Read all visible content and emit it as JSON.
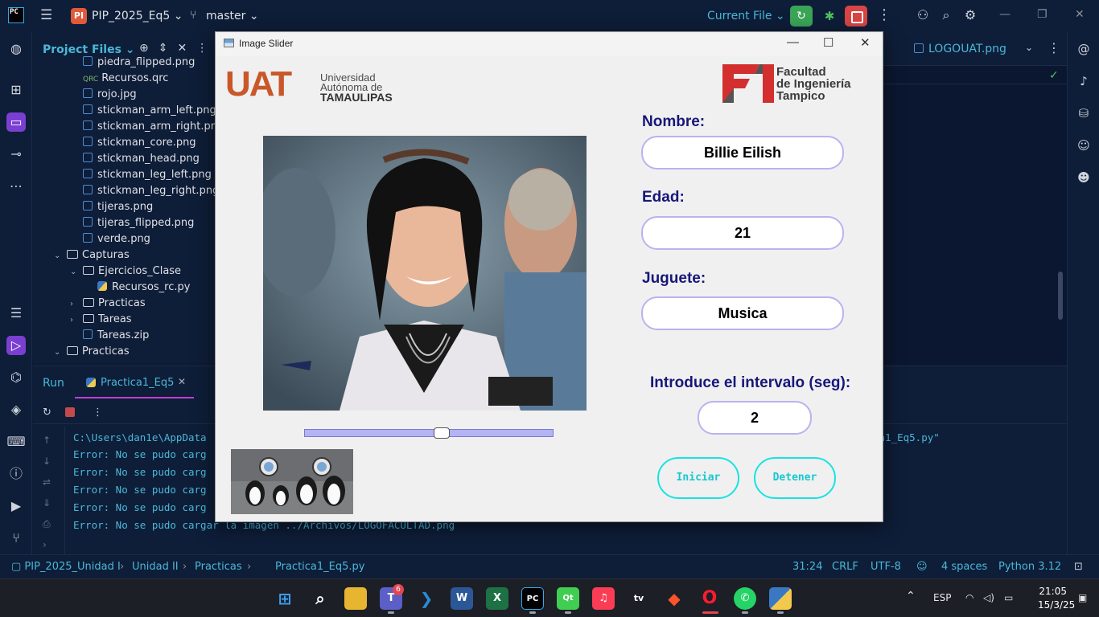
{
  "ide": {
    "logo_text": "PC",
    "project_badge": "PI",
    "project_name": "PIP_2025_Eq5 ⌄",
    "branch": "master ⌄",
    "current_file": "Current File ⌄",
    "project_panel_title": "Project Files ⌄",
    "tree": [
      {
        "label": "piedra_flipped.png",
        "type": "image",
        "indent": 3
      },
      {
        "label": "Recursos.qrc",
        "type": "qrc",
        "indent": 3
      },
      {
        "label": "rojo.jpg",
        "type": "image",
        "indent": 3
      },
      {
        "label": "stickman_arm_left.png",
        "type": "image",
        "indent": 3
      },
      {
        "label": "stickman_arm_right.png",
        "type": "image",
        "indent": 3
      },
      {
        "label": "stickman_core.png",
        "type": "image",
        "indent": 3
      },
      {
        "label": "stickman_head.png",
        "type": "image",
        "indent": 3
      },
      {
        "label": "stickman_leg_left.png",
        "type": "image",
        "indent": 3
      },
      {
        "label": "stickman_leg_right.png",
        "type": "image",
        "indent": 3
      },
      {
        "label": "tijeras.png",
        "type": "image",
        "indent": 3
      },
      {
        "label": "tijeras_flipped.png",
        "type": "image",
        "indent": 3
      },
      {
        "label": "verde.png",
        "type": "image",
        "indent": 3
      },
      {
        "label": "Capturas",
        "type": "folder-open",
        "indent": 2
      },
      {
        "label": "Ejercicios_Clase",
        "type": "folder-open",
        "indent": 3
      },
      {
        "label": "Recursos_rc.py",
        "type": "python",
        "indent": 4
      },
      {
        "label": "Practicas",
        "type": "folder-closed",
        "indent": 3
      },
      {
        "label": "Tareas",
        "type": "folder-closed",
        "indent": 3
      },
      {
        "label": "Tareas.zip",
        "type": "image",
        "indent": 3
      },
      {
        "label": "Practicas",
        "type": "folder-open",
        "indent": 2
      }
    ],
    "editor_tab": "LOGOUAT.png",
    "run_label": "Run",
    "run_tab": "Practica1_Eq5",
    "console": [
      "C:\\Users\\dan1e\\AppData",
      "Error: No se pudo carg",
      "Error: No se pudo carg",
      "Error: No se pudo carg",
      "Error: No se pudo carg",
      "Error: No se pudo cargar la imagen ../Archivos/LOGOFACULTAD.png"
    ],
    "console_right": "ca1_Eq5.py\"",
    "status": {
      "breadcrumb": [
        "PIP_2025_Unidad I",
        "Unidad II",
        "Practicas",
        "Practica1_Eq5.py"
      ],
      "position": "31:24",
      "line_ending": "CRLF",
      "encoding": "UTF-8",
      "indent": "4 spaces",
      "interpreter": "Python 3.12"
    }
  },
  "app": {
    "window_title": "Image Slider",
    "uat_logo": {
      "big": "UAT",
      "line1": "Universidad",
      "line2": "Autónoma de",
      "line3": "TAMAULIPAS"
    },
    "fi_logo": {
      "line1": "Facultad",
      "line2": "de Ingeniería",
      "line3": "Tampico"
    },
    "nombre_label": "Nombre:",
    "nombre_value": "Billie Eilish",
    "edad_label": "Edad:",
    "edad_value": "21",
    "juguete_label": "Juguete:",
    "juguete_value": "Musica",
    "interval_label": "Introduce el intervalo (seg):",
    "interval_value": "2",
    "start_button": "Iniciar",
    "stop_button": "Detener",
    "slider_position": 0.55
  },
  "taskbar": {
    "teams_badge": "6",
    "lang": "ESP",
    "time": "21:05",
    "date": "15/3/25"
  }
}
